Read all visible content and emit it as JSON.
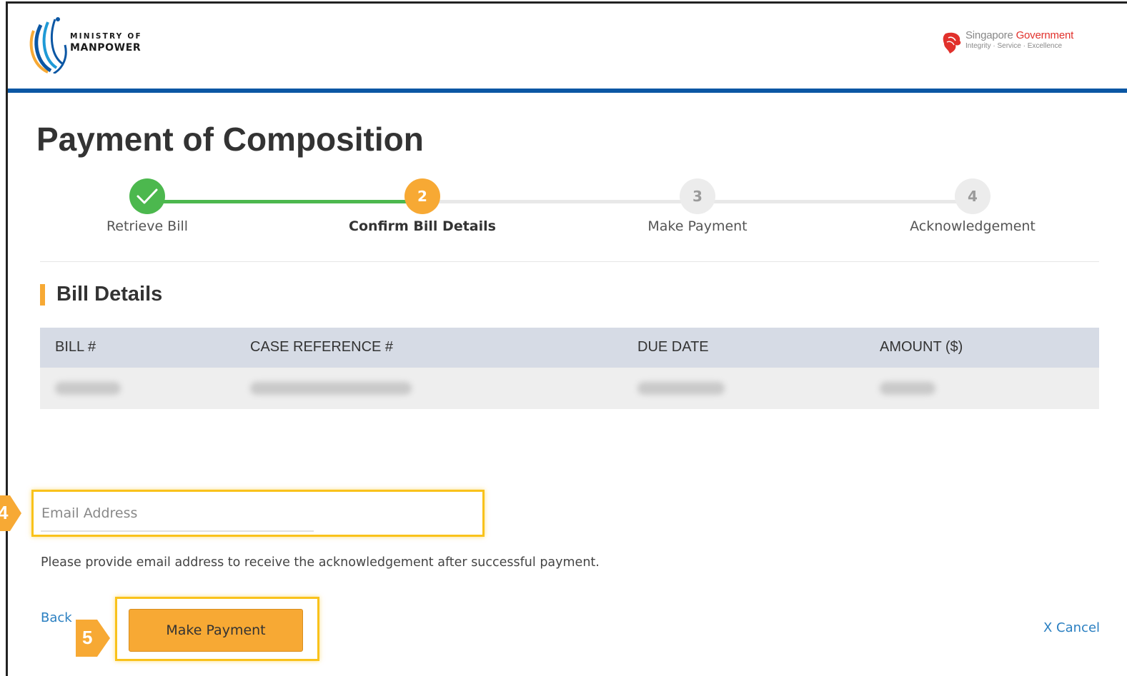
{
  "header": {
    "ministry_line1": "MINISTRY OF",
    "ministry_line2": "MANPOWER",
    "sg_name_part1": "Singapore ",
    "sg_name_part2": "Government",
    "sg_tagline": "Integrity · Service · Excellence"
  },
  "page": {
    "title": "Payment of Composition"
  },
  "stepper": {
    "steps": [
      {
        "label": "Retrieve Bill",
        "state": "done",
        "number": ""
      },
      {
        "label": "Confirm Bill Details",
        "state": "active",
        "number": "2"
      },
      {
        "label": "Make Payment",
        "state": "todo",
        "number": "3"
      },
      {
        "label": "Acknowledgement",
        "state": "todo",
        "number": "4"
      }
    ]
  },
  "bill_details": {
    "title": "Bill Details",
    "columns": [
      "BILL #",
      "CASE REFERENCE #",
      "DUE DATE",
      "AMOUNT ($)"
    ]
  },
  "email": {
    "placeholder": "Email Address",
    "value": "",
    "helper_text": "Please provide email address to receive the acknowledgement after successful payment."
  },
  "actions": {
    "back_label": "Back",
    "pay_label": "Make Payment",
    "cancel_label": "X Cancel"
  },
  "callouts": {
    "email_step": "4",
    "pay_step": "5"
  },
  "colors": {
    "brand_blue": "#0b57a4",
    "accent_orange": "#f7a934",
    "done_green": "#4cb84e",
    "highlight_yellow": "#f9c21b",
    "link_blue": "#2a7fc1"
  }
}
